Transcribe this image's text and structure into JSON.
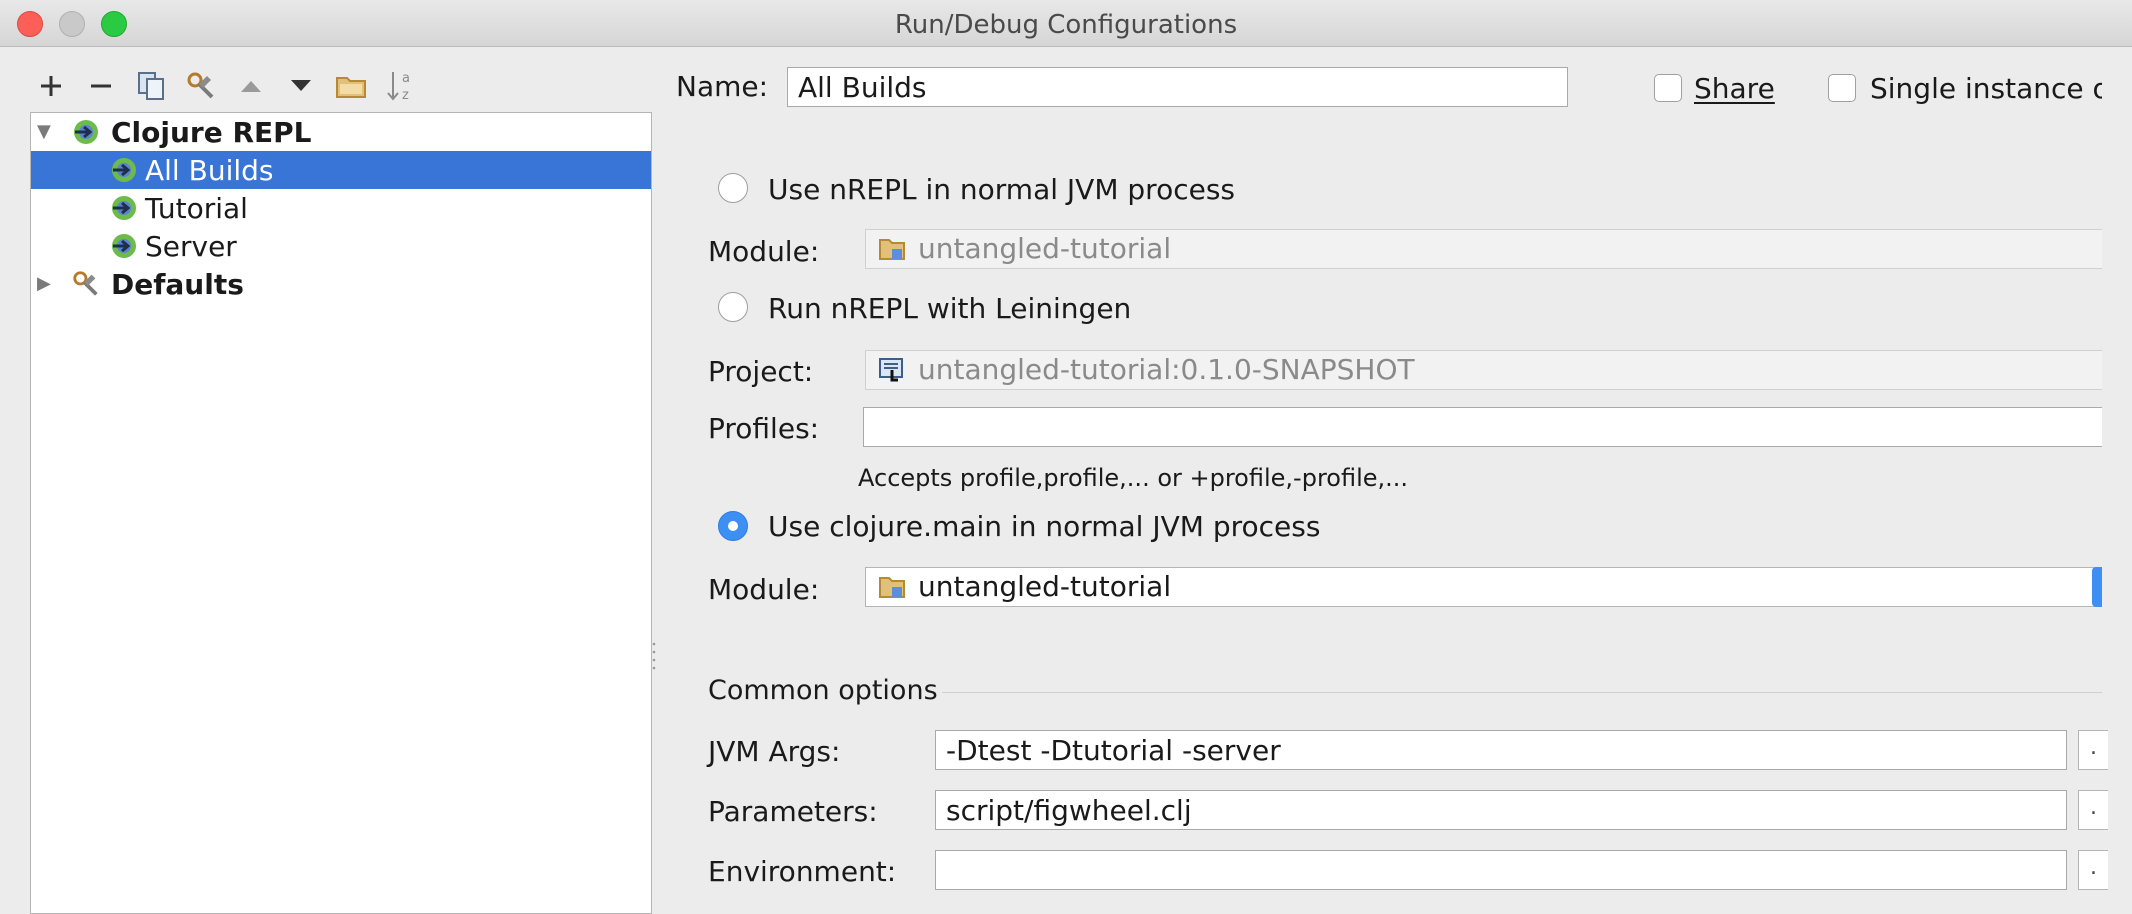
{
  "window": {
    "title": "Run/Debug Configurations"
  },
  "toolbar": {
    "add_icon": "plus-icon",
    "remove_icon": "minus-icon",
    "copy_icon": "copy-icon",
    "edit_defaults_icon": "wrench-icon",
    "move_up_icon": "arrow-up-icon",
    "move_down_icon": "arrow-down-icon",
    "folder_icon": "folder-icon",
    "sort_icon": "sort-alpha-icon"
  },
  "tree": {
    "group": "Clojure REPL",
    "items": [
      {
        "label": "All Builds",
        "selected": true
      },
      {
        "label": "Tutorial",
        "selected": false
      },
      {
        "label": "Server",
        "selected": false
      }
    ],
    "defaults": "Defaults"
  },
  "form": {
    "name_label": "Name:",
    "name_value": "All Builds",
    "share_label": "Share",
    "share_checked": false,
    "single_instance_label": "Single instance o",
    "single_instance_checked": false,
    "option1_label": "Use nREPL in normal JVM process",
    "option1_selected": false,
    "module1_label": "Module:",
    "module1_value": "untangled-tutorial",
    "option2_label": "Run nREPL with Leiningen",
    "option2_selected": false,
    "project_label": "Project:",
    "project_value": "untangled-tutorial:0.1.0-SNAPSHOT",
    "profiles_label": "Profiles:",
    "profiles_value": "",
    "profiles_hint": "Accepts profile,profile,... or +profile,-profile,...",
    "option3_label": "Use clojure.main in normal JVM process",
    "option3_selected": true,
    "module2_label": "Module:",
    "module2_value": "untangled-tutorial",
    "common_options_label": "Common options",
    "jvm_args_label": "JVM Args:",
    "jvm_args_value": "-Dtest -Dtutorial -server",
    "parameters_label": "Parameters:",
    "parameters_value": "script/figwheel.clj",
    "environment_label": "Environment:",
    "environment_value": "",
    "browse_label": "."
  },
  "colors": {
    "selection": "#3875d7",
    "radio_on": "#3d8ff4",
    "close": "#fc5f57",
    "zoom": "#2acb42"
  }
}
